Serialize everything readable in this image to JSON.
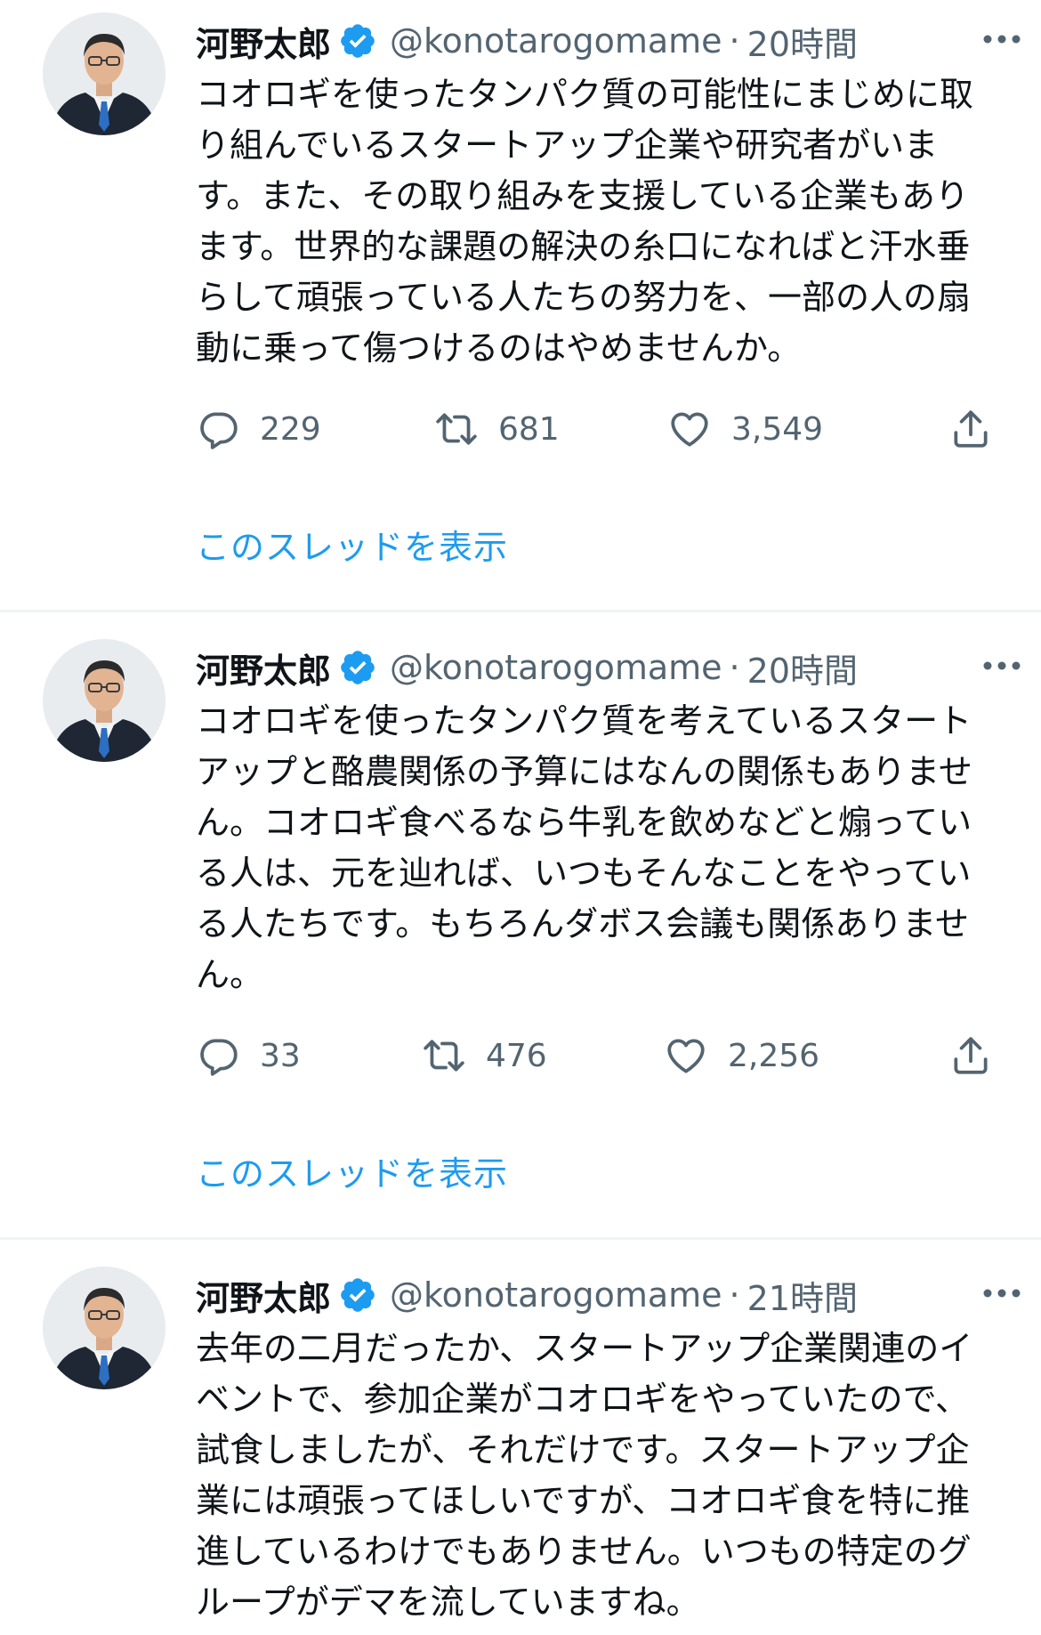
{
  "colors": {
    "accent": "#1d9bf0",
    "text_primary": "#0f1419",
    "text_secondary": "#536471",
    "divider": "#eff3f4"
  },
  "tweets": [
    {
      "name": "河野太郎",
      "handle": "@konotarogomame",
      "separator": "·",
      "time": "20時間",
      "text": "コオロギを使ったタンパク質の可能性にまじめに取り組んでいるスタートアップ企業や研究者がいます。また、その取り組みを支援している企業もあります。世界的な課題の解決の糸口になればと汗水垂らして頑張っている人たちの努力を、一部の人の扇動に乗って傷つけるのはやめませんか。",
      "replies": "229",
      "retweets": "681",
      "likes": "3,549",
      "thread_link": "このスレッドを表示"
    },
    {
      "name": "河野太郎",
      "handle": "@konotarogomame",
      "separator": "·",
      "time": "20時間",
      "text": "コオロギを使ったタンパク質を考えているスタートアップと酪農関係の予算にはなんの関係もありません。コオロギ食べるなら牛乳を飲めなどと煽っている人は、元を辿れば、いつもそんなことをやっている人たちです。もちろんダボス会議も関係ありません。",
      "replies": "33",
      "retweets": "476",
      "likes": "2,256",
      "thread_link": "このスレッドを表示"
    },
    {
      "name": "河野太郎",
      "handle": "@konotarogomame",
      "separator": "·",
      "time": "21時間",
      "text": "去年の二月だったか、スタートアップ企業関連のイベントで、参加企業がコオロギをやっていたので、試食しましたが、それだけです。スタートアップ企業には頑張ってほしいですが、コオロギ食を特に推進しているわけでもありません。いつもの特定のグループがデマを流していますね。"
    }
  ],
  "icons": {
    "verified": "verified-badge-icon",
    "more": "more-dots-icon",
    "reply": "reply-bubble-icon",
    "retweet": "retweet-arrows-icon",
    "like": "heart-icon",
    "share": "share-upload-icon"
  }
}
